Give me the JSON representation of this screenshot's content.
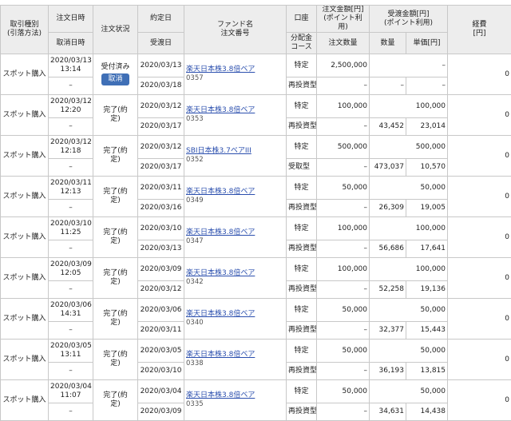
{
  "headers": {
    "type": "取引種別\n(引落方法)",
    "order_datetime": "注文日時",
    "cancel_datetime": "取消日時",
    "status": "注文状況",
    "contract_date": "約定日",
    "delivery_date": "受渡日",
    "fund_name": "ファンド名\n注文番号",
    "account": "口座",
    "dist_course": "分配金\nコース",
    "order_amount": "注文金額[円]\n(ポイント利用)",
    "order_qty": "注文数量",
    "deliv_amount": "受渡金額[円]\n(ポイント利用)",
    "qty": "数量",
    "unit_price": "単価[円]",
    "fee": "経費\n[円]"
  },
  "orders": [
    {
      "type": "スポット購入",
      "order_dt": "2020/03/13\n13:14",
      "cancel_dt": "–",
      "status": "受付済み",
      "cancel_button": "取消",
      "contract": "2020/03/13",
      "delivery": "2020/03/18",
      "fund": "楽天日本株3.8倍ベア",
      "number": "0357",
      "account": "特定",
      "course": "再投資型",
      "order_amount": "2,500,000",
      "order_qty": "–",
      "deliv_amount": "–",
      "qty": "–",
      "unit": "–",
      "fee": "0"
    },
    {
      "type": "スポット購入",
      "order_dt": "2020/03/12\n12:20",
      "cancel_dt": "–",
      "status": "完了(約\n定)",
      "contract": "2020/03/12",
      "delivery": "2020/03/17",
      "fund": "楽天日本株3.8倍ベア",
      "number": "0353",
      "account": "特定",
      "course": "再投資型",
      "order_amount": "100,000",
      "order_qty": "–",
      "deliv_amount": "100,000",
      "qty": "43,452",
      "unit": "23,014",
      "fee": "0"
    },
    {
      "type": "スポット購入",
      "order_dt": "2020/03/12\n12:18",
      "cancel_dt": "–",
      "status": "完了(約\n定)",
      "contract": "2020/03/12",
      "delivery": "2020/03/17",
      "fund": "SBI日本株3.7ベアIII",
      "number": "0352",
      "account": "特定",
      "course": "受取型",
      "order_amount": "500,000",
      "order_qty": "–",
      "deliv_amount": "500,000",
      "qty": "473,037",
      "unit": "10,570",
      "fee": "0"
    },
    {
      "type": "スポット購入",
      "order_dt": "2020/03/11\n12:13",
      "cancel_dt": "–",
      "status": "完了(約\n定)",
      "contract": "2020/03/11",
      "delivery": "2020/03/16",
      "fund": "楽天日本株3.8倍ベア",
      "number": "0349",
      "account": "特定",
      "course": "再投資型",
      "order_amount": "50,000",
      "order_qty": "–",
      "deliv_amount": "50,000",
      "qty": "26,309",
      "unit": "19,005",
      "fee": "0"
    },
    {
      "type": "スポット購入",
      "order_dt": "2020/03/10\n11:25",
      "cancel_dt": "–",
      "status": "完了(約\n定)",
      "contract": "2020/03/10",
      "delivery": "2020/03/13",
      "fund": "楽天日本株3.8倍ベア",
      "number": "0347",
      "account": "特定",
      "course": "再投資型",
      "order_amount": "100,000",
      "order_qty": "–",
      "deliv_amount": "100,000",
      "qty": "56,686",
      "unit": "17,641",
      "fee": "0"
    },
    {
      "type": "スポット購入",
      "order_dt": "2020/03/09\n12:05",
      "cancel_dt": "–",
      "status": "完了(約\n定)",
      "contract": "2020/03/09",
      "delivery": "2020/03/12",
      "fund": "楽天日本株3.8倍ベア",
      "number": "0342",
      "account": "特定",
      "course": "再投資型",
      "order_amount": "100,000",
      "order_qty": "–",
      "deliv_amount": "100,000",
      "qty": "52,258",
      "unit": "19,136",
      "fee": "0"
    },
    {
      "type": "スポット購入",
      "order_dt": "2020/03/06\n14:31",
      "cancel_dt": "–",
      "status": "完了(約\n定)",
      "contract": "2020/03/06",
      "delivery": "2020/03/11",
      "fund": "楽天日本株3.8倍ベア",
      "number": "0340",
      "account": "特定",
      "course": "再投資型",
      "order_amount": "50,000",
      "order_qty": "–",
      "deliv_amount": "50,000",
      "qty": "32,377",
      "unit": "15,443",
      "fee": "0"
    },
    {
      "type": "スポット購入",
      "order_dt": "2020/03/05\n13:11",
      "cancel_dt": "–",
      "status": "完了(約\n定)",
      "contract": "2020/03/05",
      "delivery": "2020/03/10",
      "fund": "楽天日本株3.8倍ベア",
      "number": "0338",
      "account": "特定",
      "course": "再投資型",
      "order_amount": "50,000",
      "order_qty": "–",
      "deliv_amount": "50,000",
      "qty": "36,193",
      "unit": "13,815",
      "fee": "0"
    },
    {
      "type": "スポット購入",
      "order_dt": "2020/03/04\n11:07",
      "cancel_dt": "–",
      "status": "完了(約\n定)",
      "contract": "2020/03/04",
      "delivery": "2020/03/09",
      "fund": "楽天日本株3.8倍ベア",
      "number": "0335",
      "account": "特定",
      "course": "再投資型",
      "order_amount": "50,000",
      "order_qty": "–",
      "deliv_amount": "50,000",
      "qty": "34,631",
      "unit": "14,438",
      "fee": "0"
    }
  ]
}
